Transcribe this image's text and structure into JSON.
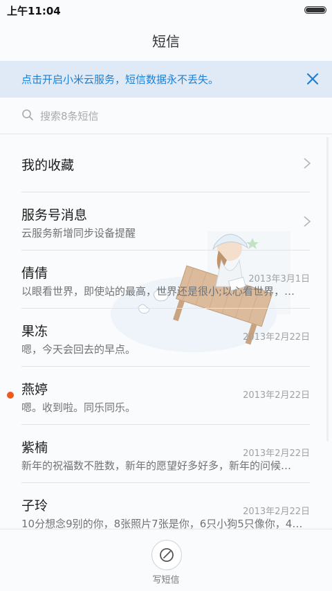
{
  "status_bar": {
    "time": "上午11:04"
  },
  "header": {
    "title": "短信"
  },
  "banner": {
    "text": "点击开启小米云服务，短信数据永不丢失。"
  },
  "search": {
    "placeholder": "搜索8条短信"
  },
  "conversations": [
    {
      "name": "我的收藏",
      "snippet": "",
      "date": "",
      "unread": false,
      "has_chevron": true
    },
    {
      "name": "服务号消息",
      "snippet": "云服务新增同步设备提醒",
      "date": "",
      "unread": false,
      "has_chevron": true
    },
    {
      "name": "倩倩",
      "snippet": "以眼看世界，即使站的最高，世界还是很小;以心看世界，…",
      "date": "2013年3月1日",
      "unread": false
    },
    {
      "name": "果冻",
      "snippet": "嗯，今天会回去的早点。",
      "date": "2013年2月22日",
      "unread": false
    },
    {
      "name": "燕婷",
      "snippet": "嗯。收到啦。同乐同乐。",
      "date": "2013年2月22日",
      "unread": true
    },
    {
      "name": "紫楠",
      "snippet": "新年的祝福数不胜数，新年的愿望好多好多，新年的问候…",
      "date": "2013年2月22日",
      "unread": false
    },
    {
      "name": "子玲",
      "snippet": "10分想念9别的你，8张照片7张是你，6只小狗5只像你，4…",
      "date": "2013年2月22日",
      "unread": false
    }
  ],
  "bottom_bar": {
    "compose_label": "写短信"
  },
  "colors": {
    "accent": "#1d7fd3",
    "banner_bg": "#dfeaf6",
    "unread_dot": "#ec5a1d"
  }
}
